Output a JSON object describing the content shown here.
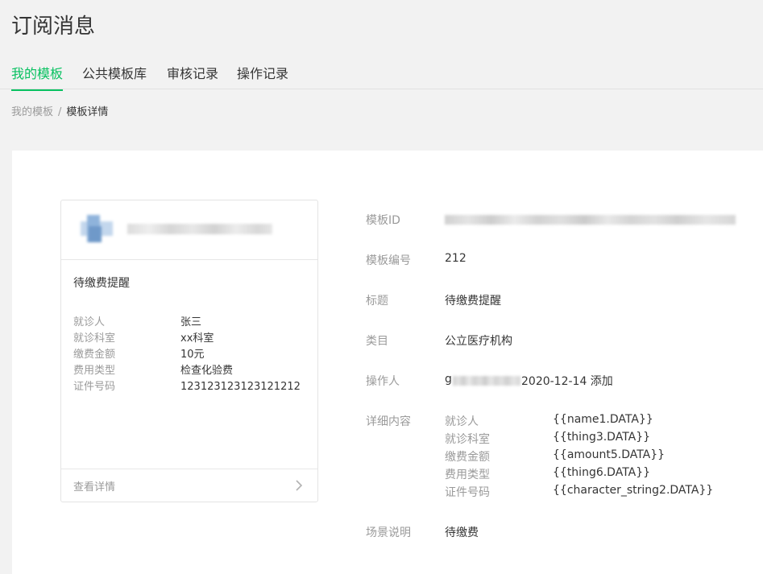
{
  "page": {
    "title": "订阅消息"
  },
  "tabs": [
    {
      "label": "我的模板",
      "active": true
    },
    {
      "label": "公共模板库",
      "active": false
    },
    {
      "label": "审核记录",
      "active": false
    },
    {
      "label": "操作记录",
      "active": false
    }
  ],
  "breadcrumb": {
    "parent": "我的模板",
    "separator": "/",
    "current": "模板详情"
  },
  "preview": {
    "title": "待缴费提醒",
    "fields": [
      {
        "key": "就诊人",
        "value": "张三"
      },
      {
        "key": "就诊科室",
        "value": "xx科室"
      },
      {
        "key": "缴费金额",
        "value": "10元"
      },
      {
        "key": "费用类型",
        "value": "检查化验费"
      },
      {
        "key": "证件号码",
        "value": "123123123123121212"
      }
    ],
    "footer_label": "查看详情",
    "footer_icon": "chevron-right-icon"
  },
  "details": {
    "template_id_label": "模板ID",
    "number_label": "模板编号",
    "number_value": "212",
    "title_label": "标题",
    "title_value": "待缴费提醒",
    "category_label": "类目",
    "category_value": "公立医疗机构",
    "operator_label": "操作人",
    "operator_prefix": "g",
    "operator_suffix": "2020-12-14 添加",
    "content_label": "详细内容",
    "keywords": [
      {
        "key": "就诊人",
        "value": "{{name1.DATA}}"
      },
      {
        "key": "就诊科室",
        "value": "{{thing3.DATA}}"
      },
      {
        "key": "缴费金额",
        "value": "{{amount5.DATA}}"
      },
      {
        "key": "费用类型",
        "value": "{{thing6.DATA}}"
      },
      {
        "key": "证件号码",
        "value": "{{character_string2.DATA}}"
      }
    ],
    "scene_label": "场景说明",
    "scene_value": "待缴费"
  },
  "colors": {
    "accent": "#07c160",
    "label": "#9a9a9a",
    "text": "#353535",
    "background": "#f2f2f2"
  }
}
